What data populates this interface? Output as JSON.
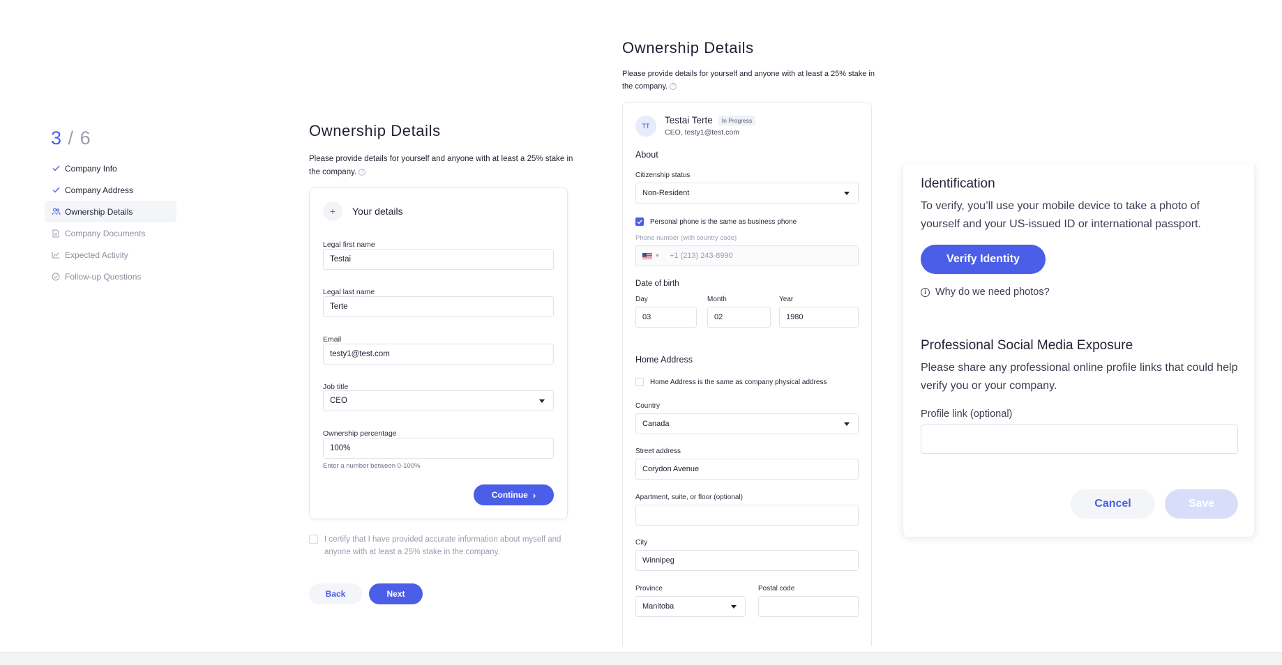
{
  "stepper": {
    "current": "3",
    "separator": "/",
    "total": "6",
    "steps": [
      {
        "label": "Company Info",
        "state": "done",
        "icon": "check-icon"
      },
      {
        "label": "Company Address",
        "state": "done",
        "icon": "check-icon"
      },
      {
        "label": "Ownership Details",
        "state": "active",
        "icon": "people-icon"
      },
      {
        "label": "Company Documents",
        "state": "todo",
        "icon": "document-icon"
      },
      {
        "label": "Expected Activity",
        "state": "todo",
        "icon": "chart-icon"
      },
      {
        "label": "Follow-up Questions",
        "state": "todo",
        "icon": "check-circle-icon"
      }
    ]
  },
  "panel1": {
    "title": "Ownership Details",
    "description": "Please provide details for yourself and anyone with at least a 25% stake in the company.",
    "card_header": "Your details",
    "fields": {
      "first_name_label": "Legal first name",
      "first_name_value": "Testai",
      "last_name_label": "Legal last name",
      "last_name_value": "Terte",
      "email_label": "Email",
      "email_value": "testy1@test.com",
      "job_title_label": "Job title",
      "job_title_value": "CEO",
      "ownership_label": "Ownership percentage",
      "ownership_value": "100%",
      "ownership_hint": "Enter a number between 0-100%"
    },
    "continue_label": "Continue",
    "certify_text": "I certify that I have provided accurate information about myself and anyone with at least a 25% stake in the company.",
    "back_label": "Back",
    "next_label": "Next"
  },
  "panel2": {
    "title": "Ownership Details",
    "description": "Please provide details for yourself and anyone with at least a 25% stake in the company.",
    "person": {
      "initials": "TT",
      "name": "Testai Terte",
      "badge": "In Progress",
      "subtitle": "CEO, testy1@test.com"
    },
    "about_heading": "About",
    "citizenship_label": "Citizenship status",
    "citizenship_value": "Non-Resident",
    "phone_same_label": "Personal phone is the same as business phone",
    "phone_label": "Phone number (with country code)",
    "phone_placeholder": "+1 (213) 243-8990",
    "dob_heading": "Date of birth",
    "day_label": "Day",
    "day_value": "03",
    "month_label": "Month",
    "month_value": "02",
    "year_label": "Year",
    "year_value": "1980",
    "home_heading": "Home Address",
    "home_same_label": "Home Address is the same as company physical address",
    "country_label": "Country",
    "country_value": "Canada",
    "street_label": "Street address",
    "street_value": "Corydon Avenue",
    "apt_label": "Apartment, suite, or floor (optional)",
    "apt_value": "",
    "city_label": "City",
    "city_value": "Winnipeg",
    "province_label": "Province",
    "province_value": "Manitoba",
    "postal_label": "Postal code",
    "postal_value": ""
  },
  "panel3": {
    "identification_title": "Identification",
    "identification_body": "To verify, you’ll use your mobile device to take a photo of yourself and your US-issued ID or international passport.",
    "verify_label": "Verify Identity",
    "why_label": "Why do we need photos?",
    "social_title": "Professional Social Media Exposure",
    "social_body": "Please share any professional online profile links that could help verify you or your company.",
    "profile_label": "Profile link (optional)",
    "profile_value": "",
    "cancel_label": "Cancel",
    "save_label": "Save"
  },
  "colors": {
    "accent": "#4a5ee8",
    "accent_disabled": "#d8defa",
    "text": "#1f2233",
    "muted": "#9a9db0"
  }
}
